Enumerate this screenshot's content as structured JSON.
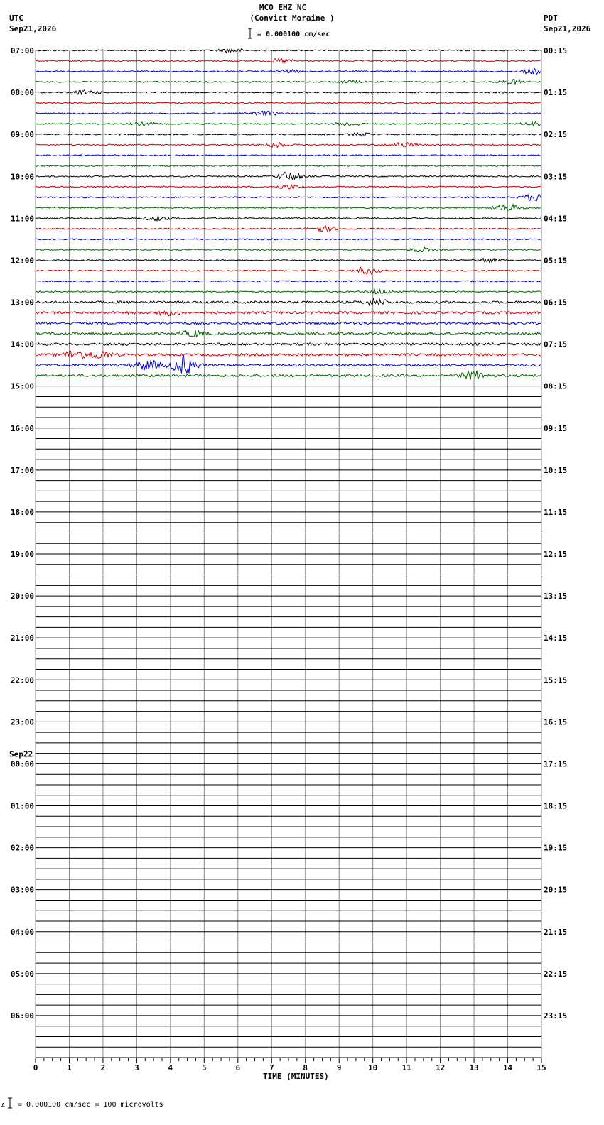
{
  "header": {
    "station": "MCO EHZ NC",
    "location": "(Convict Moraine )",
    "left_tz": "UTC",
    "left_date": "Sep21,2026",
    "right_tz": "PDT",
    "right_date": "Sep21,2026",
    "scale_text": "= 0.000100 cm/sec"
  },
  "footer": {
    "scale_text": "= 0.000100 cm/sec =     100 microvolts",
    "corner_mark": "A"
  },
  "chart_data": {
    "type": "line",
    "title": "MCO EHZ NC (Convict Moraine )",
    "xlabel": "TIME (MINUTES)",
    "xlim": [
      0,
      15
    ],
    "x_ticks": [
      "0",
      "1",
      "2",
      "3",
      "4",
      "5",
      "6",
      "7",
      "8",
      "9",
      "10",
      "11",
      "12",
      "13",
      "14",
      "15"
    ],
    "left_labels": [
      "07:00",
      "08:00",
      "09:00",
      "10:00",
      "11:00",
      "12:00",
      "13:00",
      "14:00",
      "15:00",
      "16:00",
      "17:00",
      "18:00",
      "19:00",
      "20:00",
      "21:00",
      "22:00",
      "23:00",
      "00:00",
      "01:00",
      "02:00",
      "03:00",
      "04:00",
      "05:00",
      "06:00"
    ],
    "date_change_label": "Sep22",
    "right_labels": [
      "00:15",
      "01:15",
      "02:15",
      "03:15",
      "04:15",
      "05:15",
      "06:15",
      "07:15",
      "08:15",
      "09:15",
      "10:15",
      "11:15",
      "12:15",
      "13:15",
      "14:15",
      "15:15",
      "16:15",
      "17:15",
      "18:15",
      "19:15",
      "20:15",
      "21:15",
      "22:15",
      "23:15"
    ],
    "trace_colors": [
      "#000000",
      "#cc0000",
      "#0000cc",
      "#006600"
    ],
    "rows_per_hour": 4,
    "total_rows": 96,
    "active_rows": 32,
    "activity": [
      {
        "row": 0,
        "x": 5.8,
        "amp": 3
      },
      {
        "row": 1,
        "x": 7.3,
        "amp": 3
      },
      {
        "row": 2,
        "x": 7.5,
        "amp": 2
      },
      {
        "row": 2,
        "x": 14.8,
        "amp": 4
      },
      {
        "row": 3,
        "x": 9.3,
        "amp": 2
      },
      {
        "row": 3,
        "x": 14.2,
        "amp": 3
      },
      {
        "row": 4,
        "x": 1.5,
        "amp": 3
      },
      {
        "row": 6,
        "x": 6.8,
        "amp": 3
      },
      {
        "row": 7,
        "x": 3.2,
        "amp": 2
      },
      {
        "row": 7,
        "x": 9.3,
        "amp": 3
      },
      {
        "row": 7,
        "x": 14.8,
        "amp": 3
      },
      {
        "row": 8,
        "x": 9.7,
        "amp": 2
      },
      {
        "row": 9,
        "x": 7.1,
        "amp": 3
      },
      {
        "row": 9,
        "x": 10.9,
        "amp": 3
      },
      {
        "row": 12,
        "x": 7.5,
        "amp": 6
      },
      {
        "row": 13,
        "x": 7.5,
        "amp": 3
      },
      {
        "row": 14,
        "x": 14.8,
        "amp": 5
      },
      {
        "row": 15,
        "x": 14.0,
        "amp": 5
      },
      {
        "row": 16,
        "x": 3.6,
        "amp": 3
      },
      {
        "row": 17,
        "x": 8.5,
        "amp": 4
      },
      {
        "row": 19,
        "x": 11.4,
        "amp": 3
      },
      {
        "row": 20,
        "x": 13.4,
        "amp": 3
      },
      {
        "row": 21,
        "x": 9.8,
        "amp": 5
      },
      {
        "row": 23,
        "x": 10.2,
        "amp": 3
      },
      {
        "row": 24,
        "x": 10.1,
        "amp": 4
      },
      {
        "row": 25,
        "x": 3.9,
        "amp": 3
      },
      {
        "row": 27,
        "x": 4.7,
        "amp": 4
      },
      {
        "row": 29,
        "x": 1.2,
        "amp": 6
      },
      {
        "row": 29,
        "x": 1.9,
        "amp": 5
      },
      {
        "row": 30,
        "x": 3.3,
        "amp": 7
      },
      {
        "row": 30,
        "x": 4.4,
        "amp": 12
      },
      {
        "row": 31,
        "x": 13.0,
        "amp": 6
      }
    ]
  }
}
